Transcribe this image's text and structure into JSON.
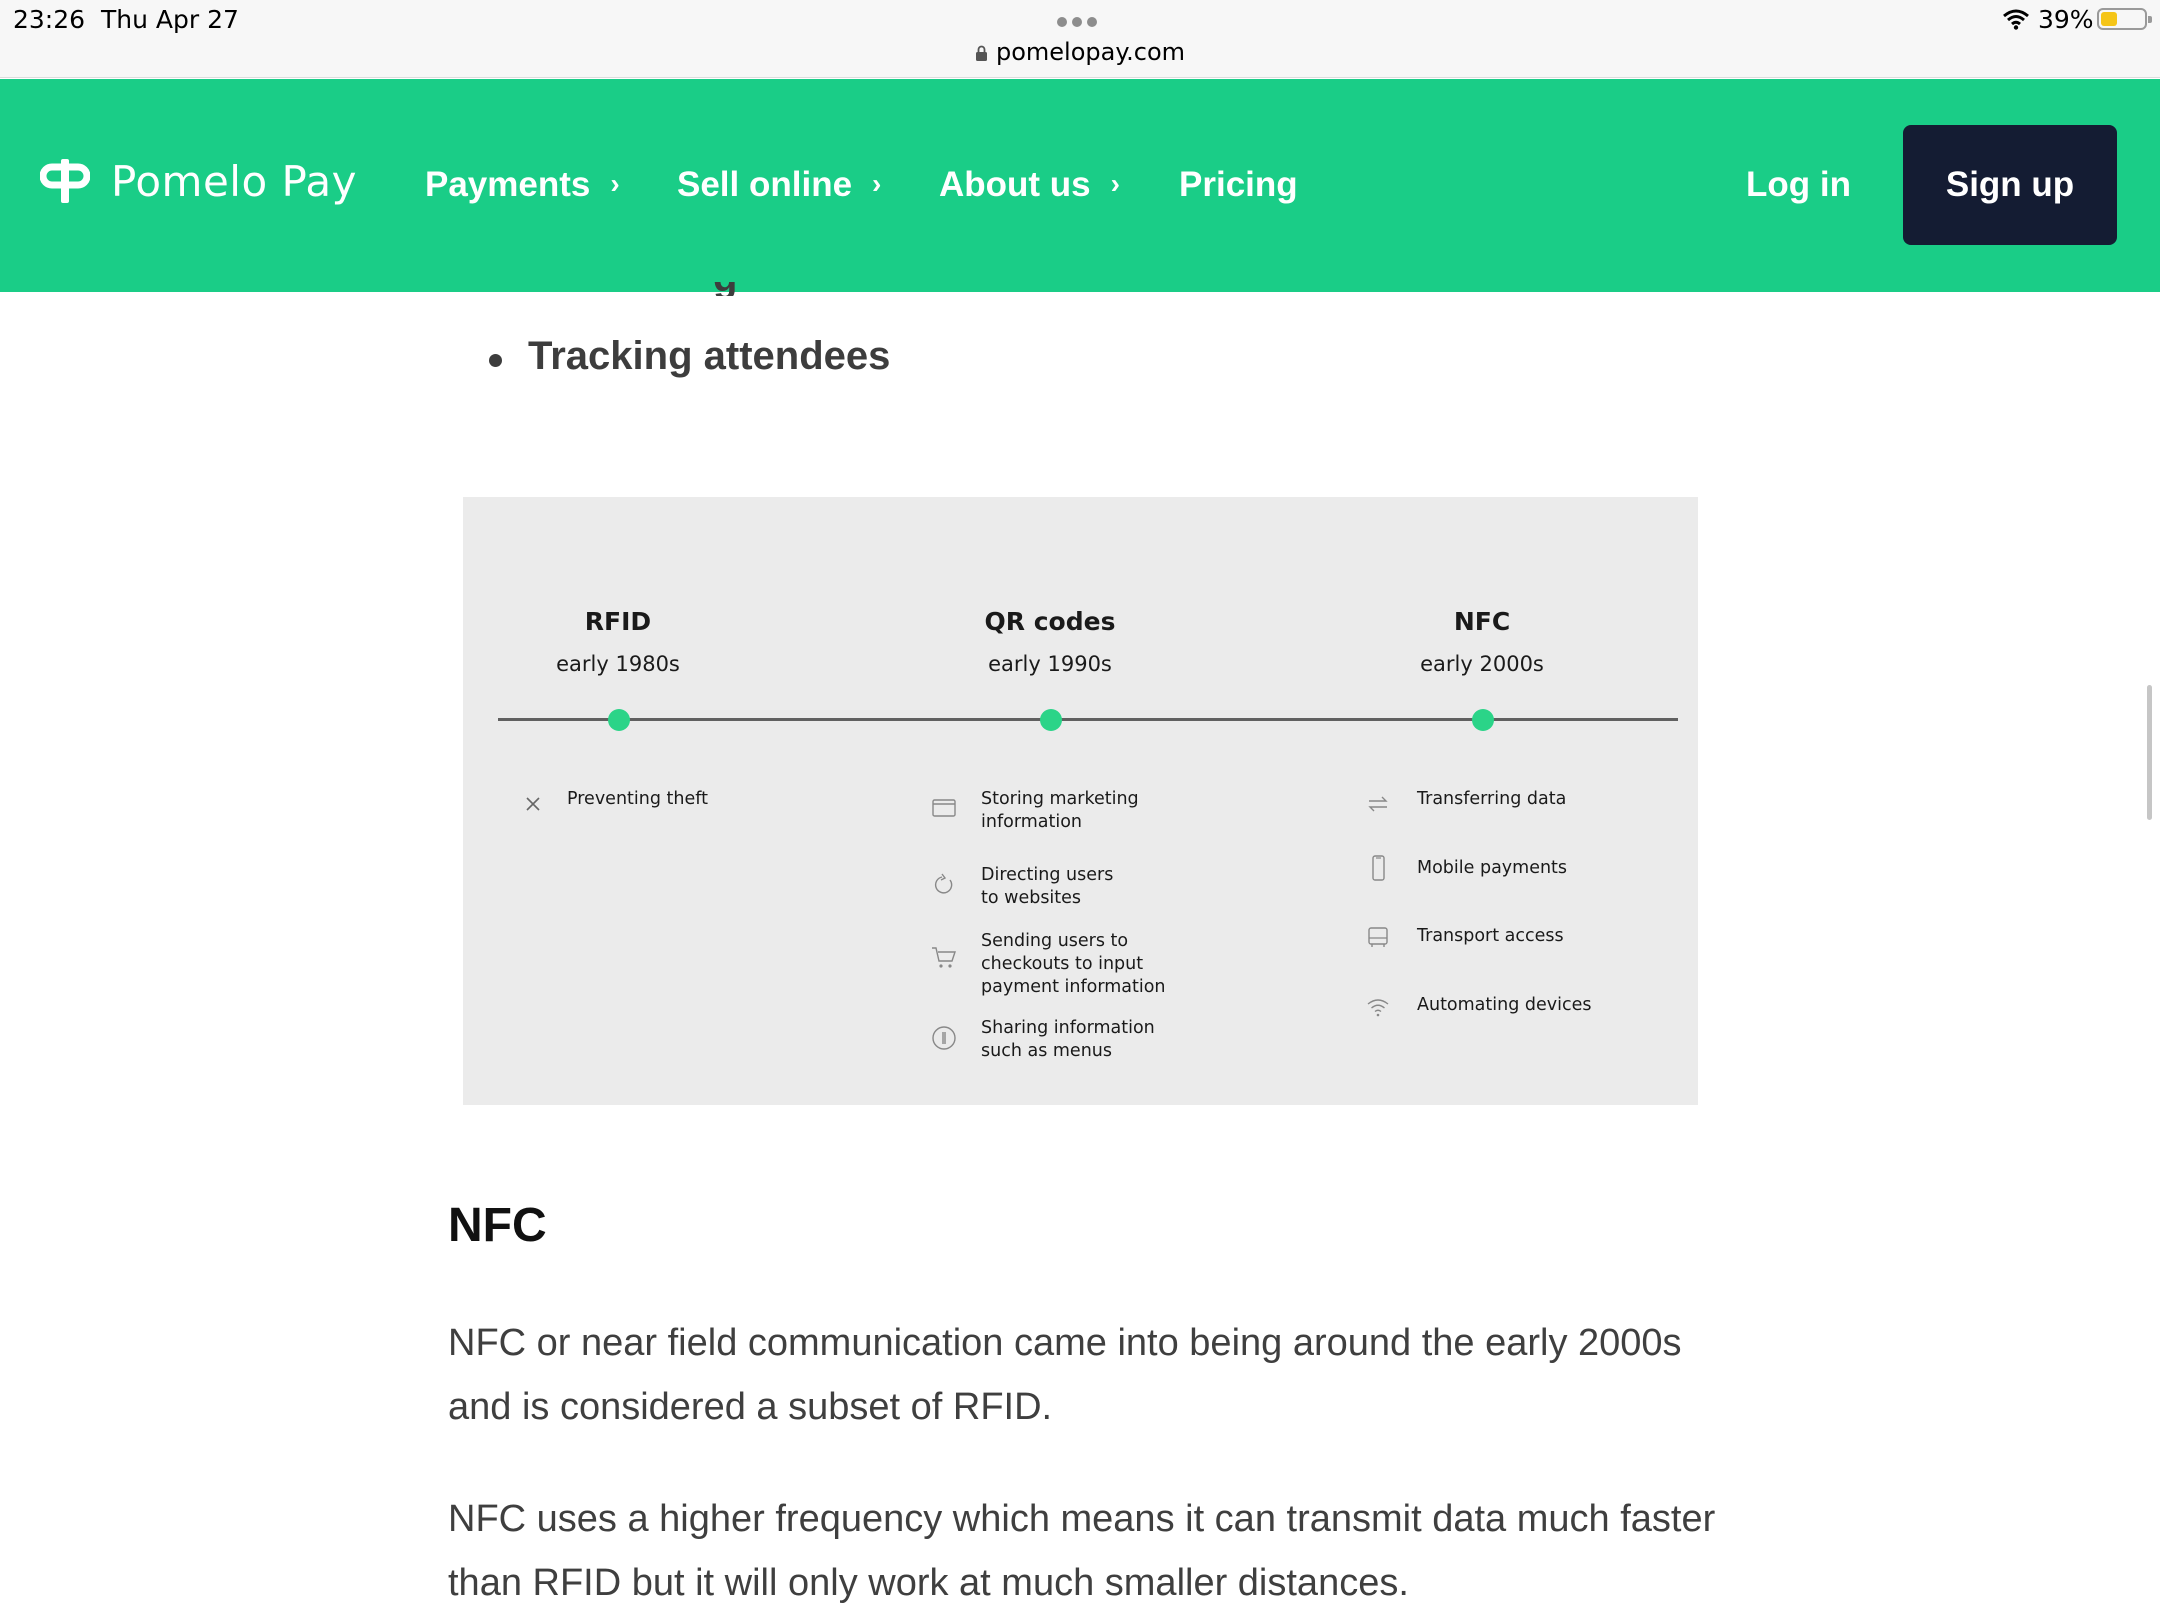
{
  "status_bar": {
    "time": "23:26",
    "date": "Thu Apr 27",
    "url": "pomelopay.com",
    "battery": "39%"
  },
  "nav": {
    "brand": "Pomelo Pay",
    "items": [
      {
        "label": "Payments",
        "has_submenu": true
      },
      {
        "label": "Sell online",
        "has_submenu": true
      },
      {
        "label": "About us",
        "has_submenu": true
      },
      {
        "label": "Pricing",
        "has_submenu": false
      }
    ],
    "login": "Log in",
    "signup": "Sign up",
    "colors": {
      "bar": "#1acd87",
      "signup_bg": "#141c33"
    }
  },
  "article": {
    "bullet": "Tracking attendees",
    "timeline": {
      "columns": [
        {
          "title": "RFID",
          "date": "early 1980s",
          "items": [
            {
              "icon": "x-icon",
              "label": "Preventing theft"
            }
          ]
        },
        {
          "title": "QR codes",
          "date": "early 1990s",
          "items": [
            {
              "icon": "card-icon",
              "label": "Storing marketing\ninformation"
            },
            {
              "icon": "link-icon",
              "label": "Directing users\nto websites"
            },
            {
              "icon": "cart-icon",
              "label": "Sending users to\ncheckouts to input\npayment information"
            },
            {
              "icon": "info-icon",
              "label": "Sharing information\nsuch as menus"
            }
          ]
        },
        {
          "title": "NFC",
          "date": "early 2000s",
          "items": [
            {
              "icon": "transfer-icon",
              "label": "Transferring data"
            },
            {
              "icon": "phone-icon",
              "label": "Mobile payments"
            },
            {
              "icon": "bus-icon",
              "label": "Transport access"
            },
            {
              "icon": "wifi-icon",
              "label": "Automating devices"
            }
          ]
        }
      ],
      "dot_color": "#2bd488"
    },
    "heading": "NFC",
    "paragraphs": [
      "NFC or near field communication came into being around the early 2000s and is considered a subset of RFID.",
      "NFC uses a higher frequency which means it can transmit data much faster than RFID but it will only work at much smaller distances."
    ]
  }
}
